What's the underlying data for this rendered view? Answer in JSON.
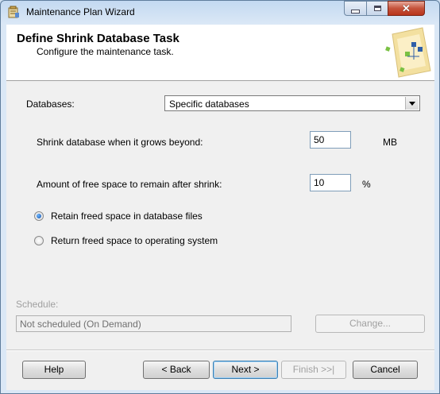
{
  "window": {
    "title": "Maintenance Plan Wizard"
  },
  "header": {
    "title": "Define Shrink Database Task",
    "subtitle": "Configure the maintenance task."
  },
  "databases": {
    "label": "Databases:",
    "selected": "Specific databases"
  },
  "shrink": {
    "grow_label": "Shrink database when it grows beyond:",
    "grow_value": "50",
    "grow_unit": "MB",
    "free_label": "Amount of free space to remain after shrink:",
    "free_value": "10",
    "free_unit": "%"
  },
  "options": {
    "retain_label": "Retain freed space in database files",
    "retain_selected": true,
    "return_label": "Return freed space to operating system",
    "return_selected": false
  },
  "schedule": {
    "label": "Schedule:",
    "value": "Not scheduled (On Demand)",
    "change_label": "Change..."
  },
  "buttons": {
    "help": "Help",
    "back": "< Back",
    "next": "Next >",
    "finish": "Finish >>|",
    "cancel": "Cancel"
  },
  "icons": {
    "app": "wizard-app-icon",
    "header_art": "wizard-header-art-icon",
    "dropdown": "chevron-down-icon"
  }
}
